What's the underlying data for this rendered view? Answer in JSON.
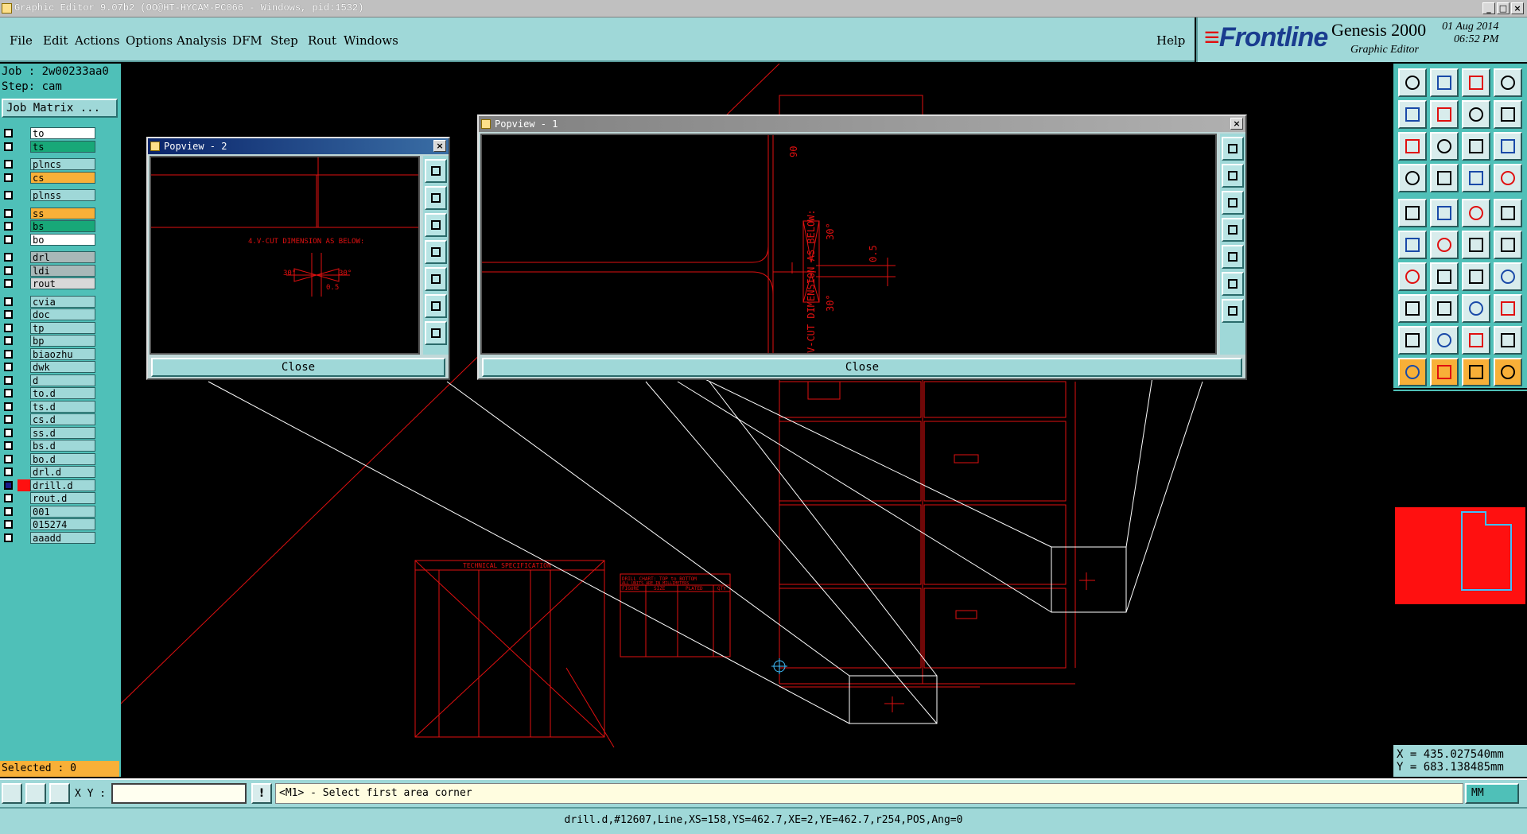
{
  "window": {
    "title": "Graphic Editor 9.07b2 (OO@HT-HYCAM-PC066 - Windows, pid:1532)",
    "minimize": "_",
    "maximize": "□",
    "close": "×"
  },
  "menu": [
    "File",
    "Edit",
    "Actions",
    "Options",
    "Analysis",
    "DFM",
    "Step",
    "Rout",
    "Windows"
  ],
  "help": "Help",
  "brand": {
    "logo": "Frontline",
    "product": "Genesis 2000",
    "subtitle": "Graphic Editor",
    "date": "01 Aug 2014",
    "time": "06:52 PM"
  },
  "job": {
    "job_line": "Job : 2w00233aa0",
    "step_line": "Step: cam",
    "matrix_button": "Job Matrix ..."
  },
  "layers": [
    {
      "name": "to",
      "color": "#ffffff",
      "mark": "◢",
      "group": 0
    },
    {
      "name": "ts",
      "color": "#18a878",
      "mark": "",
      "group": 0
    },
    {
      "name": "plncs",
      "color": "#9fd8d8",
      "mark": "",
      "group": 1
    },
    {
      "name": "cs",
      "color": "#f8b038",
      "mark": "",
      "group": 1
    },
    {
      "name": "plnss",
      "color": "#9fd8d8",
      "mark": "",
      "group": 2
    },
    {
      "name": "ss",
      "color": "#f8b038",
      "mark": "",
      "group": 3
    },
    {
      "name": "bs",
      "color": "#18a878",
      "mark": "",
      "group": 3
    },
    {
      "name": "bo",
      "color": "#ffffff",
      "mark": "",
      "group": 3
    },
    {
      "name": "drl",
      "color": "#a8b8b8",
      "mark": "",
      "group": 4
    },
    {
      "name": "ldi",
      "color": "#a8b8b8",
      "mark": "",
      "group": 4
    },
    {
      "name": "rout",
      "color": "#d8d8d8",
      "mark": "",
      "group": 4
    },
    {
      "name": "cvia",
      "color": "#9fd8d8",
      "mark": "",
      "group": 5
    },
    {
      "name": "doc",
      "color": "#9fd8d8",
      "mark": "◢",
      "group": 5
    },
    {
      "name": "tp",
      "color": "#9fd8d8",
      "mark": "",
      "group": 5
    },
    {
      "name": "bp",
      "color": "#9fd8d8",
      "mark": "",
      "group": 5
    },
    {
      "name": "biaozhu",
      "color": "#9fd8d8",
      "mark": "",
      "group": 5
    },
    {
      "name": "dwk",
      "color": "#9fd8d8",
      "mark": "",
      "group": 5
    },
    {
      "name": "d",
      "color": "#9fd8d8",
      "mark": "",
      "group": 5
    },
    {
      "name": "to.d",
      "color": "#9fd8d8",
      "mark": "◢",
      "group": 5
    },
    {
      "name": "ts.d",
      "color": "#9fd8d8",
      "mark": "",
      "group": 5
    },
    {
      "name": "cs.d",
      "color": "#9fd8d8",
      "mark": "",
      "group": 5
    },
    {
      "name": "ss.d",
      "color": "#9fd8d8",
      "mark": "",
      "group": 5
    },
    {
      "name": "bs.d",
      "color": "#9fd8d8",
      "mark": "",
      "group": 5
    },
    {
      "name": "bo.d",
      "color": "#9fd8d8",
      "mark": "",
      "group": 5
    },
    {
      "name": "drl.d",
      "color": "#9fd8d8",
      "mark": "",
      "group": 5
    },
    {
      "name": "drill.d",
      "color": "#9fd8d8",
      "mark": "◢▣",
      "group": 5,
      "active": true
    },
    {
      "name": "rout.d",
      "color": "#9fd8d8",
      "mark": "",
      "group": 5
    },
    {
      "name": "001",
      "color": "#9fd8d8",
      "mark": "",
      "group": 5
    },
    {
      "name": "015274",
      "color": "#9fd8d8",
      "mark": "◢",
      "group": 5
    },
    {
      "name": "aaadd",
      "color": "#9fd8d8",
      "mark": "",
      "group": 5
    }
  ],
  "selected": "Selected : 0",
  "popview1": {
    "title": "Popview - 1",
    "close": "Close",
    "label": "V-CUT DIMENSION AS BELOW:",
    "angle": "30°",
    "depth": "0.5",
    "edge_label": "90"
  },
  "popview2": {
    "title": "Popview - 2",
    "close": "Close",
    "label": "4.V-CUT DIMENSION AS BELOW:",
    "angle": "30°",
    "depth": "0.5"
  },
  "drawing": {
    "spec_title": "TECHNICAL SPECIFICATION",
    "drill_title": "DRILL CHART: TOP to BOTTOM",
    "drill_subtitle": "ALL UNITS ARE IN MILLIMETERS",
    "drill_headers": [
      "FIGURE",
      "SIZE",
      "PLATED",
      "QTY"
    ]
  },
  "coords": {
    "x": "X = 435.027540mm",
    "y": "Y = 683.138485mm"
  },
  "cmd": {
    "xy_label": "X Y :",
    "xy_value": "",
    "info": "!",
    "prompt": "<M1> - Select first area corner",
    "units": "MM"
  },
  "status": "drill.d,#12607,Line,XS=158,YS=462.7,XE=2,YE=462.7,r254,POS,Ang=0"
}
